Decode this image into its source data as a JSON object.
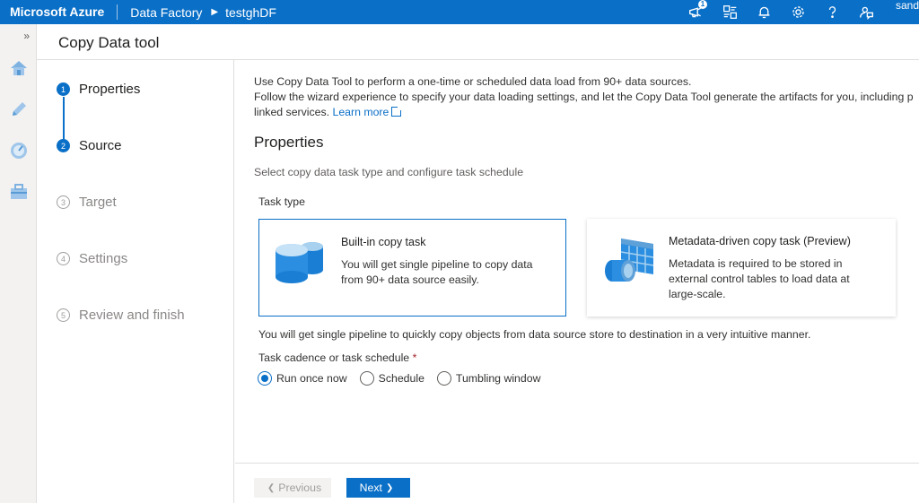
{
  "topbar": {
    "brand": "Microsoft Azure",
    "crumbs": [
      "Data Factory",
      "testghDF"
    ],
    "notification_count": "1",
    "user": "sand",
    "icons": [
      "feedback-icon",
      "directory-icon",
      "bell-icon",
      "gear-icon",
      "help-icon",
      "person-feedback-icon"
    ]
  },
  "rail": {
    "expand": "»",
    "icons": [
      "home-icon",
      "pencil-icon",
      "monitor-icon",
      "toolbox-icon"
    ]
  },
  "header": {
    "title": "Copy Data tool"
  },
  "steps": [
    {
      "number": "1",
      "label": "Properties",
      "state": "active"
    },
    {
      "number": "2",
      "label": "Source",
      "state": "active"
    },
    {
      "number": "3",
      "label": "Target",
      "state": "inactive"
    },
    {
      "number": "4",
      "label": "Settings",
      "state": "inactive"
    },
    {
      "number": "5",
      "label": "Review and finish",
      "state": "inactive"
    }
  ],
  "main": {
    "intro_line1": "Use Copy Data Tool to perform a one-time or scheduled data load from 90+ data sources.",
    "intro_line2": "Follow the wizard experience to specify your data loading settings, and let the Copy Data Tool generate the artifacts for you, including p",
    "intro_line3": "linked services.",
    "learn_more": "Learn more",
    "section_title": "Properties",
    "section_subtitle": "Select copy data task type and configure task schedule",
    "task_type_label": "Task type",
    "cards": [
      {
        "title": "Built-in copy task",
        "description": "You will get single pipeline to copy data from 90+ data source easily.",
        "selected": true
      },
      {
        "title": "Metadata-driven copy task (Preview)",
        "description": "Metadata is required to be stored in external control tables to load data at large-scale.",
        "selected": false
      }
    ],
    "task_description": "You will get single pipeline to quickly copy objects from data source store to destination in a very intuitive manner.",
    "cadence_label": "Task cadence or task schedule",
    "required_mark": "*",
    "cadence_options": [
      {
        "label": "Run once now",
        "selected": true
      },
      {
        "label": "Schedule",
        "selected": false
      },
      {
        "label": "Tumbling window",
        "selected": false
      }
    ]
  },
  "footer": {
    "previous": "Previous",
    "next": "Next"
  },
  "colors": {
    "accent": "#0a6fc7",
    "disabled": "#a19f9d"
  }
}
